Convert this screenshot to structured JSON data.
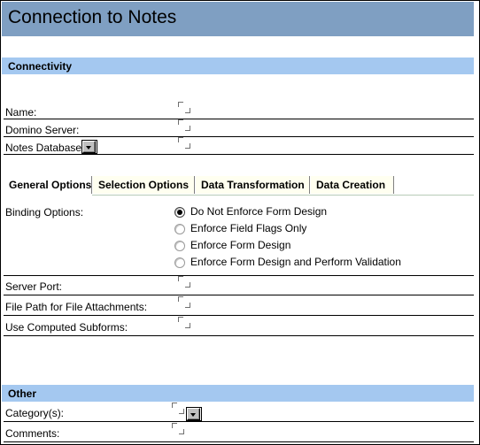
{
  "window": {
    "title": "Connection to Notes"
  },
  "sections": {
    "connectivity": {
      "heading": "Connectivity",
      "fields": [
        {
          "label": "Name:",
          "value": "",
          "control": "text"
        },
        {
          "label": "Domino Server:",
          "value": "",
          "control": "text"
        },
        {
          "label": "Notes Database:",
          "value": "",
          "control": "dropdown"
        }
      ]
    },
    "other": {
      "heading": "Other",
      "fields": [
        {
          "label": "Category(s):",
          "value": "",
          "control": "dropdown"
        },
        {
          "label": "Comments:",
          "value": "",
          "control": "text"
        }
      ]
    }
  },
  "tabs": {
    "items": [
      {
        "label": "General Options",
        "active": true
      },
      {
        "label": "Selection Options",
        "active": false
      },
      {
        "label": "Data Transformation",
        "active": false
      },
      {
        "label": "Data Creation",
        "active": false
      }
    ]
  },
  "general_options": {
    "binding_options": {
      "label": "Binding Options:",
      "selected": "Do Not Enforce Form Design",
      "options": [
        {
          "label": "Do Not Enforce Form Design",
          "checked": true
        },
        {
          "label": "Enforce Field Flags Only",
          "checked": false
        },
        {
          "label": "Enforce Form Design",
          "checked": false
        },
        {
          "label": "Enforce Form Design and Perform Validation",
          "checked": false
        }
      ]
    },
    "fields": [
      {
        "label": "Server Port:",
        "value": "",
        "control": "text"
      },
      {
        "label": "File Path for File Attachments:",
        "value": "",
        "control": "text"
      },
      {
        "label": "Use Computed Subforms:",
        "value": "",
        "control": "text"
      }
    ]
  },
  "icons": {
    "dropdown": "chevron-down-icon",
    "edit_region": "edit-region-corner-marks"
  },
  "colors": {
    "title_bar": "#7f9fc2",
    "section_bar": "#a4c8f0",
    "tab_inactive": "#fffff0",
    "tab_active": "#ffffff",
    "rule": "#000000",
    "page_background": "#ffffff"
  }
}
